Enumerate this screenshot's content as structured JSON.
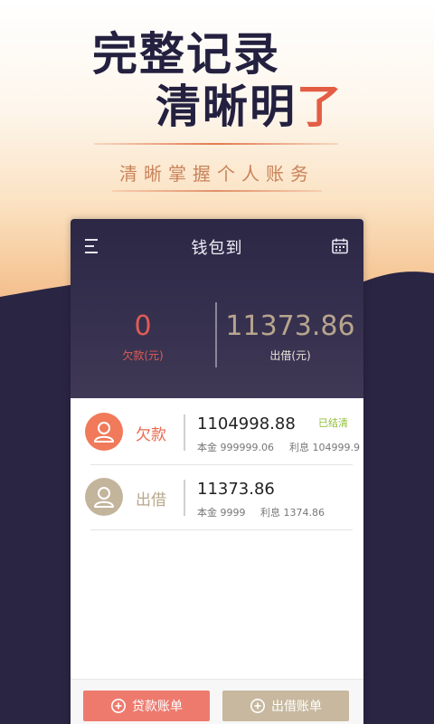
{
  "promo": {
    "headline_line1": "完整记录",
    "headline_line2_dark": "清晰明",
    "headline_line2_accent": "了",
    "subtitle": "清晰掌握个人账务"
  },
  "app": {
    "title": "钱包到",
    "summary": {
      "debt_value": "0",
      "debt_label": "欠款(元)",
      "loan_value": "11373.86",
      "loan_label": "出借(元)"
    },
    "rows": [
      {
        "label": "欠款",
        "amount": "1104998.88",
        "principal": "本金 999999.06",
        "interest": "利息 104999.9",
        "status": "已结清"
      },
      {
        "label": "出借",
        "amount": "11373.86",
        "principal": "本金 9999",
        "interest": "利息 1374.86",
        "status": ""
      }
    ],
    "footer": {
      "borrow_label": "贷款账单",
      "lend_label": "出借账单"
    }
  },
  "colors": {
    "header_bg": "#2b2745",
    "debt_accent": "#e05c55",
    "loan_accent": "#c3b59c",
    "settled_green": "#8fbf3a"
  },
  "icons": [
    "menu-icon",
    "calendar-icon",
    "person-icon",
    "add-icon"
  ]
}
